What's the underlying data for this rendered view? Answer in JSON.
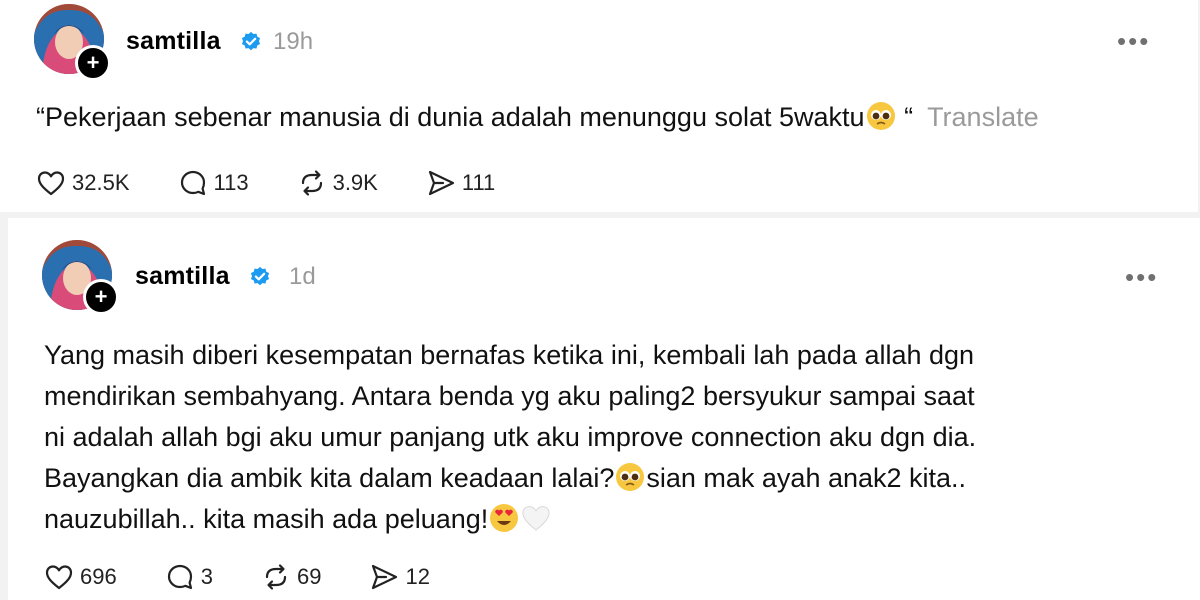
{
  "posts": [
    {
      "username": "samtilla",
      "time": "19h",
      "text_parts": [
        "“Pekerjaan sebenar manusia di dunia adalah menunggu solat 5waktu",
        " “"
      ],
      "translate_label": "Translate",
      "stats": {
        "likes": "32.5K",
        "replies": "113",
        "reposts": "3.9K",
        "shares": "111"
      }
    },
    {
      "username": "samtilla",
      "time": "1d",
      "lines": [
        "Yang masih diberi kesempatan bernafas ketika ini, kembali lah pada allah dgn",
        "mendirikan sembahyang. Antara benda yg aku paling2 bersyukur sampai saat",
        "ni adalah allah bgi aku umur panjang utk aku improve connection aku dgn dia."
      ],
      "line4_parts": [
        "Bayangkan dia ambik kita dalam keadaan lalai?",
        "sian mak ayah anak2 kita.."
      ],
      "line5_text": "nauzubillah.. kita masih ada peluang!",
      "stats": {
        "likes": "696",
        "replies": "3",
        "reposts": "69",
        "shares": "12"
      }
    }
  ],
  "icons": {
    "more": "more-options-icon",
    "verified": "verified-badge-icon",
    "follow": "follow-plus-icon",
    "like": "heart-icon",
    "reply": "reply-bubble-icon",
    "repost": "repost-icon",
    "share": "share-send-icon",
    "emojis": [
      "pleading-face-emoji",
      "heart-eyes-emoji",
      "white-heart-emoji"
    ]
  },
  "colors": {
    "verified": "#1d9bf0",
    "muted": "#9a9a9a",
    "text": "#111111"
  }
}
